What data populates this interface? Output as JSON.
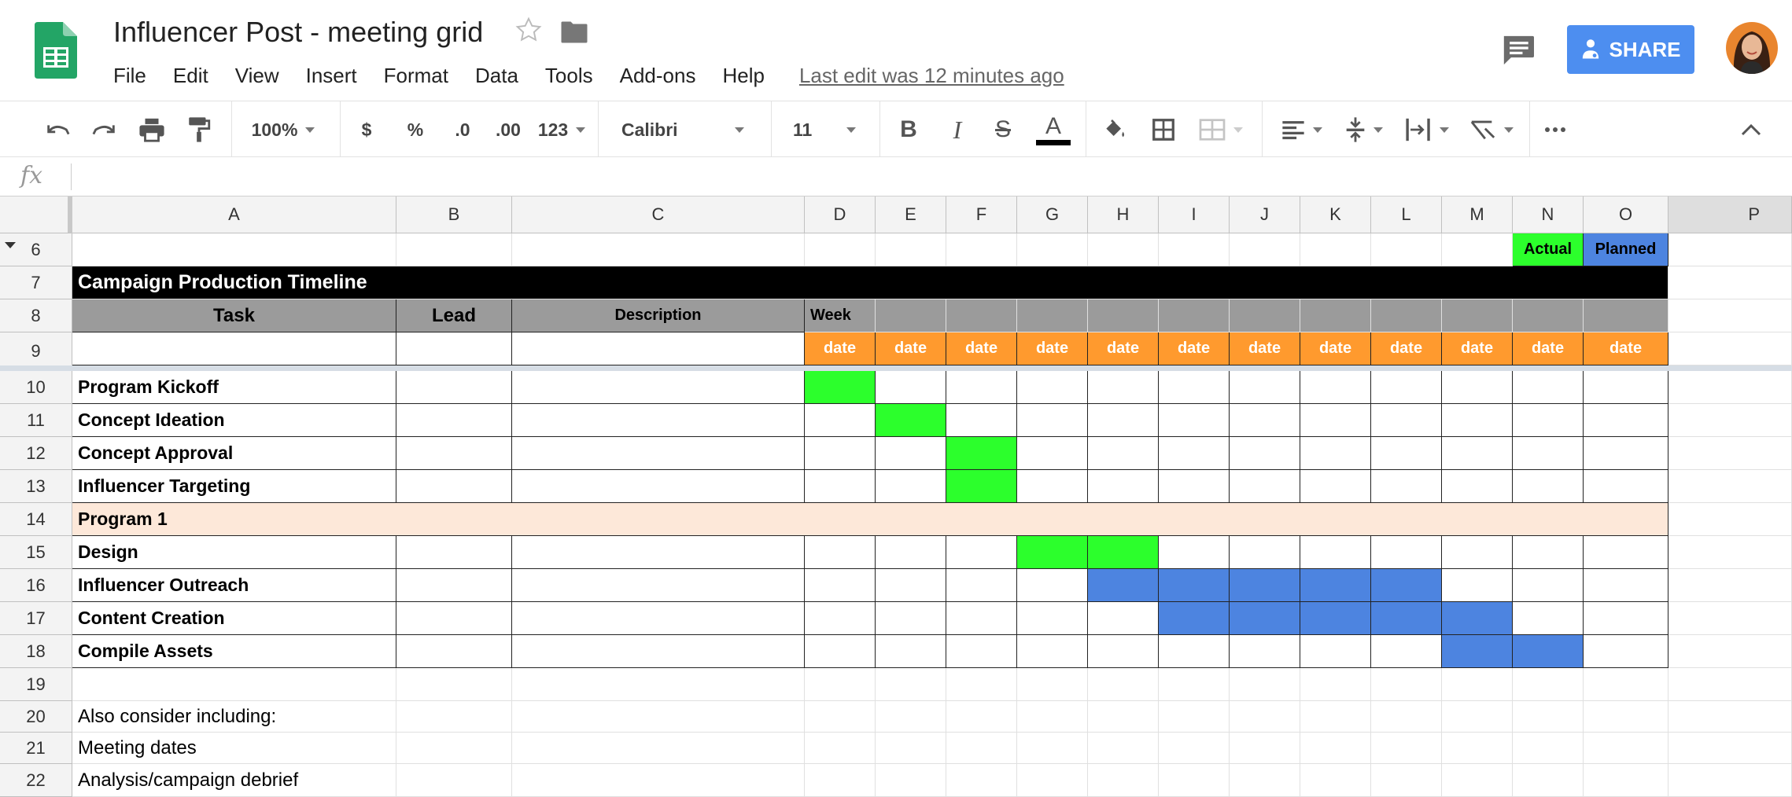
{
  "app": {
    "title": "Influencer Post - meeting grid",
    "menu": [
      "File",
      "Edit",
      "View",
      "Insert",
      "Format",
      "Data",
      "Tools",
      "Add-ons",
      "Help"
    ],
    "last_edit": "Last edit was 12 minutes ago",
    "share_label": "SHARE"
  },
  "toolbar": {
    "zoom": "100%",
    "currency": "$",
    "percent": "%",
    "decrease_decimal": ".0",
    "increase_decimal": ".00",
    "more_formats": "123",
    "font": "Calibri",
    "font_size": "11"
  },
  "formula_bar": {
    "label": "fx",
    "value": ""
  },
  "columns": [
    "A",
    "B",
    "C",
    "D",
    "E",
    "F",
    "G",
    "H",
    "I",
    "J",
    "K",
    "L",
    "M",
    "N",
    "O",
    "P"
  ],
  "rows": [
    "6",
    "7",
    "8",
    "9",
    "10",
    "11",
    "12",
    "13",
    "14",
    "15",
    "16",
    "17",
    "18",
    "19",
    "20",
    "21",
    "22"
  ],
  "legend": {
    "actual": "Actual",
    "planned": "Planned"
  },
  "sheet": {
    "timeline_title": "Campaign Production Timeline",
    "headers": {
      "task": "Task",
      "lead": "Lead",
      "description": "Description",
      "week": "Week"
    },
    "date_label": "date",
    "tasks": [
      {
        "name": "Program Kickoff",
        "actual": [
          "D"
        ],
        "planned": []
      },
      {
        "name": "Concept Ideation",
        "actual": [
          "E"
        ],
        "planned": []
      },
      {
        "name": "Concept Approval",
        "actual": [
          "F"
        ],
        "planned": []
      },
      {
        "name": "Influencer Targeting",
        "actual": [
          "F"
        ],
        "planned": []
      },
      {
        "name": "Program 1",
        "section": true
      },
      {
        "name": "Design",
        "actual": [
          "G",
          "H"
        ],
        "planned": []
      },
      {
        "name": "Influencer Outreach",
        "actual": [],
        "planned": [
          "H",
          "I",
          "J",
          "K",
          "L"
        ]
      },
      {
        "name": "Content Creation",
        "actual": [],
        "planned": [
          "I",
          "J",
          "K",
          "L",
          "M"
        ]
      },
      {
        "name": "Compile Assets",
        "actual": [],
        "planned": [
          "M",
          "N"
        ]
      }
    ],
    "notes": [
      "Also consider including:",
      "Meeting dates",
      "Analysis/campaign debrief"
    ]
  },
  "colors": {
    "actual": "#2cff2c",
    "planned": "#4d84e0",
    "date_bg": "#ff9a2e",
    "header_gray": "#9b9b9b",
    "title_bg": "#000000",
    "section_bg": "#fde8d9",
    "share_bg": "#4d8ef0"
  }
}
